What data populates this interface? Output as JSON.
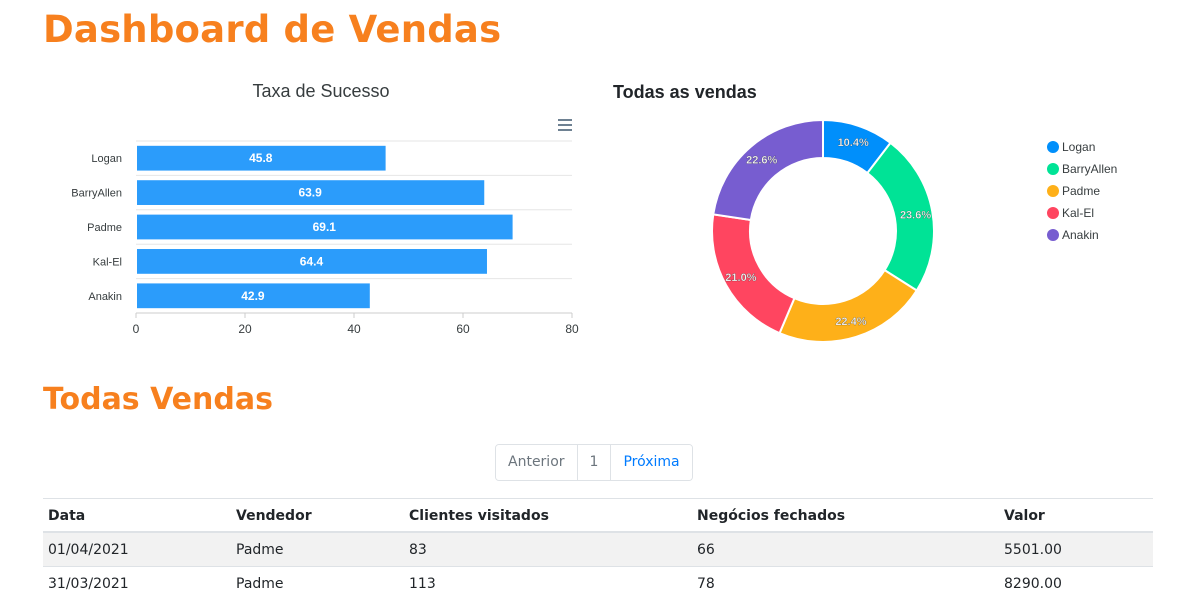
{
  "page": {
    "title": "Dashboard de Vendas",
    "section_title": "Todas Vendas"
  },
  "colors": {
    "accent": "#f7801e",
    "bar": "#2b9cfb",
    "link": "#007bff"
  },
  "icons": {
    "chart_menu": "hamburger-menu-icon"
  },
  "chart_data": [
    {
      "type": "bar",
      "orientation": "horizontal",
      "title": "Taxa de Sucesso",
      "categories": [
        "Logan",
        "BarryAllen",
        "Padme",
        "Kal-El",
        "Anakin"
      ],
      "values": [
        45.8,
        63.9,
        69.1,
        64.4,
        42.9
      ],
      "xlim": [
        0,
        80
      ],
      "xticks": [
        0,
        20,
        40,
        60,
        80
      ],
      "grid": true,
      "data_labels": true,
      "color": "#2b9cfb"
    },
    {
      "type": "pie",
      "variant": "donut",
      "title": "Todas as vendas",
      "categories": [
        "Logan",
        "BarryAllen",
        "Padme",
        "Kal-El",
        "Anakin"
      ],
      "values": [
        10.4,
        23.6,
        22.4,
        21.0,
        22.6
      ],
      "labels": [
        "10.4%",
        "23.6%",
        "22.4%",
        "21.0%",
        "22.6%"
      ],
      "colors": [
        "#008ffb",
        "#00e396",
        "#feb019",
        "#ff4560",
        "#775dd0"
      ],
      "legend": "right"
    }
  ],
  "pagination": {
    "prev": "Anterior",
    "page": "1",
    "next": "Próxima"
  },
  "table": {
    "headers": [
      "Data",
      "Vendedor",
      "Clientes visitados",
      "Negócios fechados",
      "Valor"
    ],
    "rows": [
      [
        "01/04/2021",
        "Padme",
        "83",
        "66",
        "5501.00"
      ],
      [
        "31/03/2021",
        "Padme",
        "113",
        "78",
        "8290.00"
      ]
    ]
  }
}
